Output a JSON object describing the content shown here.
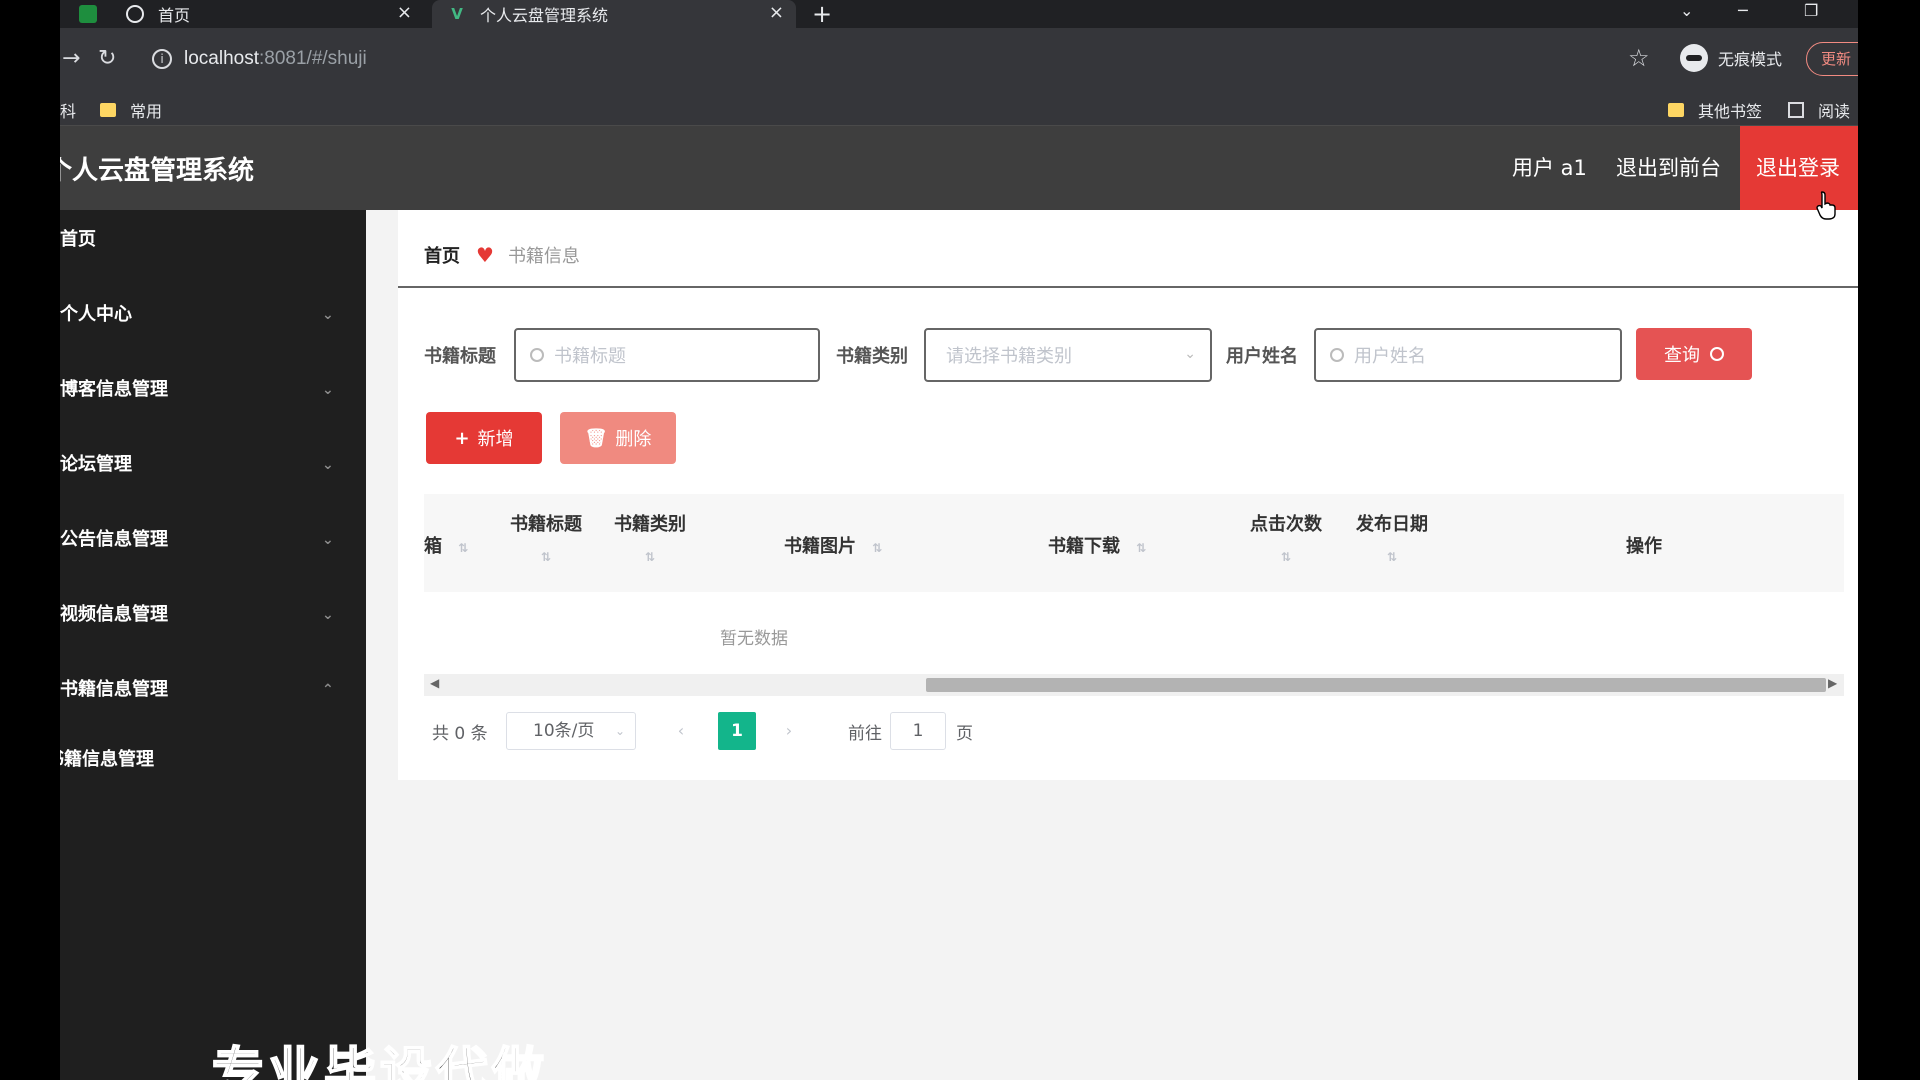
{
  "browser": {
    "tabs": [
      {
        "title": "首页"
      },
      {
        "title": "个人云盘管理系统"
      }
    ],
    "url_host": "localhost",
    "url_path": ":8081/#/shuji",
    "incognito_label": "无痕模式",
    "update_label": "更新",
    "bookmarks": [
      {
        "label": "科"
      },
      {
        "label": "常用"
      },
      {
        "label": "其他书签"
      },
      {
        "label": "阅读"
      }
    ]
  },
  "app": {
    "title": "个人云盘管理系统",
    "user_label": "用户 a1",
    "front_label": "退出到前台",
    "logout_label": "退出登录"
  },
  "sidebar": {
    "items": [
      {
        "label": "首页",
        "expandable": false
      },
      {
        "label": "个人中心",
        "expandable": true
      },
      {
        "label": "博客信息管理",
        "expandable": true
      },
      {
        "label": "论坛管理",
        "expandable": true
      },
      {
        "label": "公告信息管理",
        "expandable": true
      },
      {
        "label": "视频信息管理",
        "expandable": true
      },
      {
        "label": "书籍信息管理",
        "expandable": true,
        "expanded": true
      }
    ],
    "sub_item": "书籍信息管理"
  },
  "breadcrumb": {
    "home": "首页",
    "current": "书籍信息"
  },
  "filters": {
    "title_label": "书籍标题",
    "title_placeholder": "书籍标题",
    "category_label": "书籍类别",
    "category_placeholder": "请选择书籍类别",
    "username_label": "用户姓名",
    "username_placeholder": "用户姓名",
    "query_label": "查询"
  },
  "actions": {
    "add_label": "新增",
    "delete_label": "删除"
  },
  "table": {
    "columns": [
      "箱",
      "书籍标题",
      "书籍类别",
      "书籍图片",
      "书籍下载",
      "点击次数",
      "发布日期",
      "操作"
    ],
    "empty_text": "暂无数据"
  },
  "pagination": {
    "total_text": "共 0 条",
    "page_size": "10条/页",
    "current_page": "1",
    "goto_label": "前往",
    "goto_value": "1",
    "page_suffix": "页"
  },
  "watermark": "专业毕设代做",
  "colors": {
    "primary_red": "#e53935",
    "pager_active": "#13b58b",
    "sidebar_bg": "#1f1f1f",
    "topnav_bg": "#3e3e3e"
  }
}
